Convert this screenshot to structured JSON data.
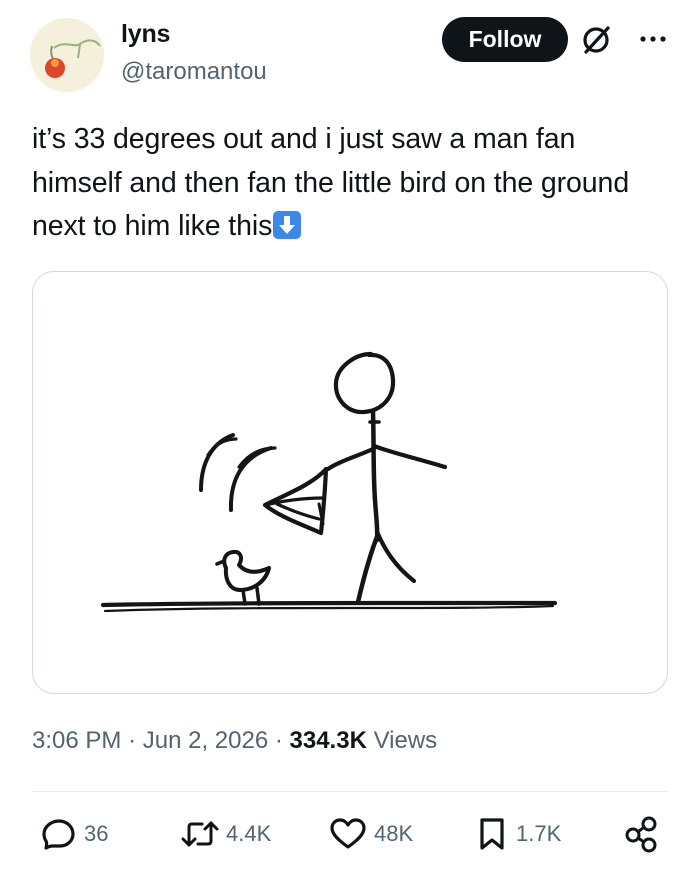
{
  "author": {
    "display_name": "lyns",
    "handle": "@taromantou"
  },
  "header": {
    "follow_label": "Follow",
    "grok_icon": "grok-icon",
    "more_icon": "more-dots-icon"
  },
  "tweet": {
    "text": "it’s 33 degrees out and i just saw a man fan himself and then fan the little bird on the ground next to him like this",
    "emoji": "down-arrow-emoji"
  },
  "meta": {
    "time": "3:06 PM",
    "sep1": "·",
    "date": "Jun 2, 2026",
    "sep2": "·",
    "views_count": "334.3K",
    "views_label": "Views"
  },
  "actions": {
    "reply": {
      "icon": "reply-icon",
      "count": "36"
    },
    "repost": {
      "icon": "repost-icon",
      "count": "4.4K"
    },
    "like": {
      "icon": "heart-icon",
      "count": "48K"
    },
    "bookmark": {
      "icon": "bookmark-icon",
      "count": "1.7K"
    },
    "share": {
      "icon": "share-icon"
    }
  },
  "colors": {
    "text": "#0f1419",
    "secondary": "#536471",
    "border": "#cfd9de",
    "emoji_blue": "#3b88e8"
  }
}
